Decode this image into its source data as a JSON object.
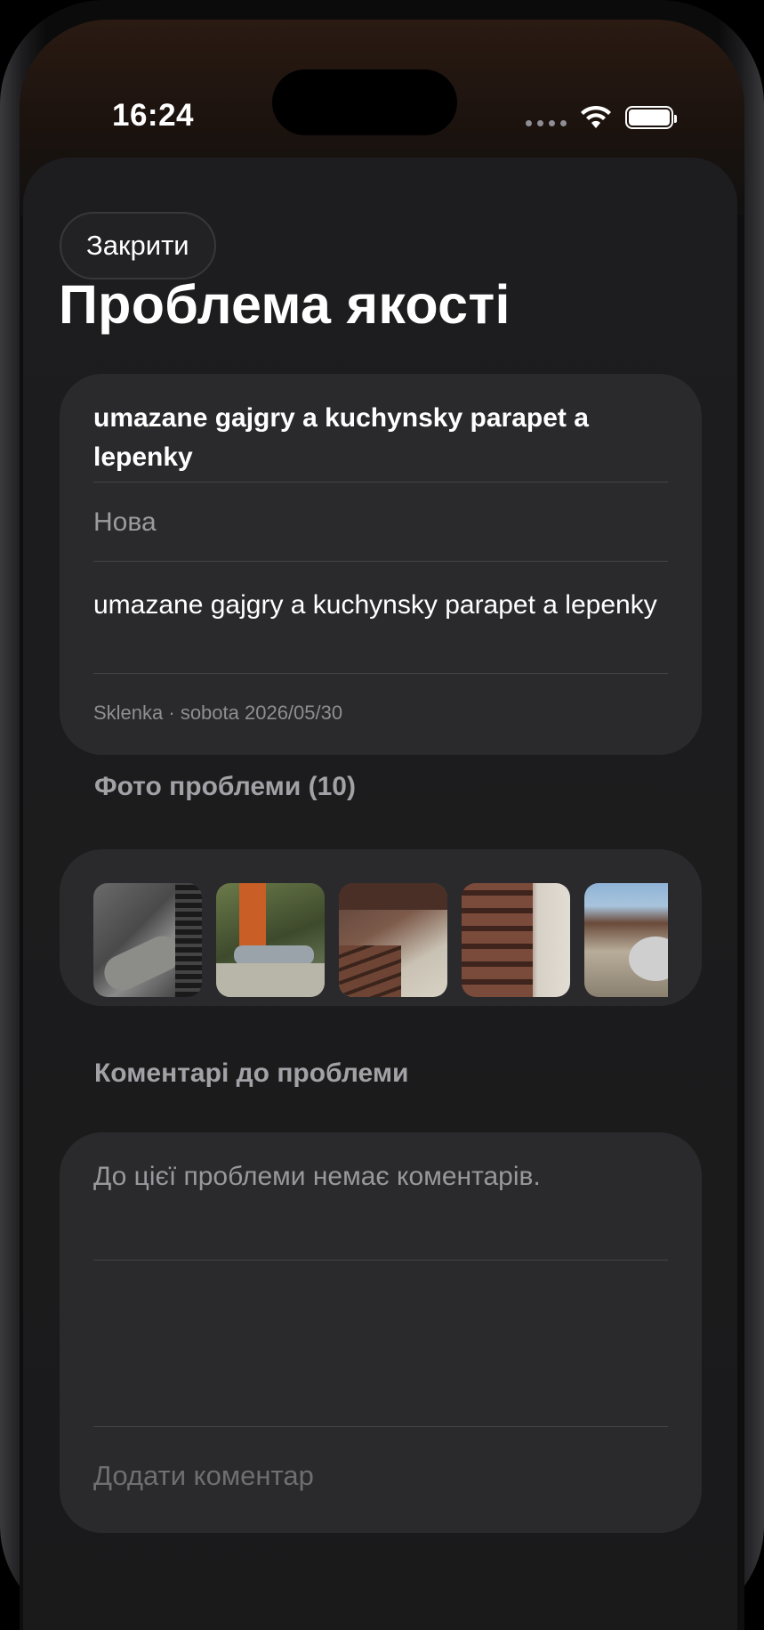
{
  "status_bar": {
    "time": "16:24"
  },
  "header": {
    "close_label": "Закрити",
    "title": "Проблема якості"
  },
  "issue": {
    "title": "umazane gajgry a kuchynsky parapet a lepenky",
    "status": "Нова",
    "description": "umazane gajgry a kuchynsky parapet a lepenky",
    "meta": "Sklenka · sobota 2026/05/30"
  },
  "photos": {
    "label": "Фото проблеми (10)"
  },
  "comments": {
    "label": "Коментарі до проблеми",
    "empty_text": "До цієї проблеми немає коментарів.",
    "input_placeholder": "Додати коментар"
  },
  "colors": {
    "accent": "#ffffff",
    "card": "#2a2a2c",
    "sheet": "#1d1d1f"
  },
  "icons": [
    "wifi-icon",
    "battery-icon",
    "signal-dots-icon"
  ]
}
